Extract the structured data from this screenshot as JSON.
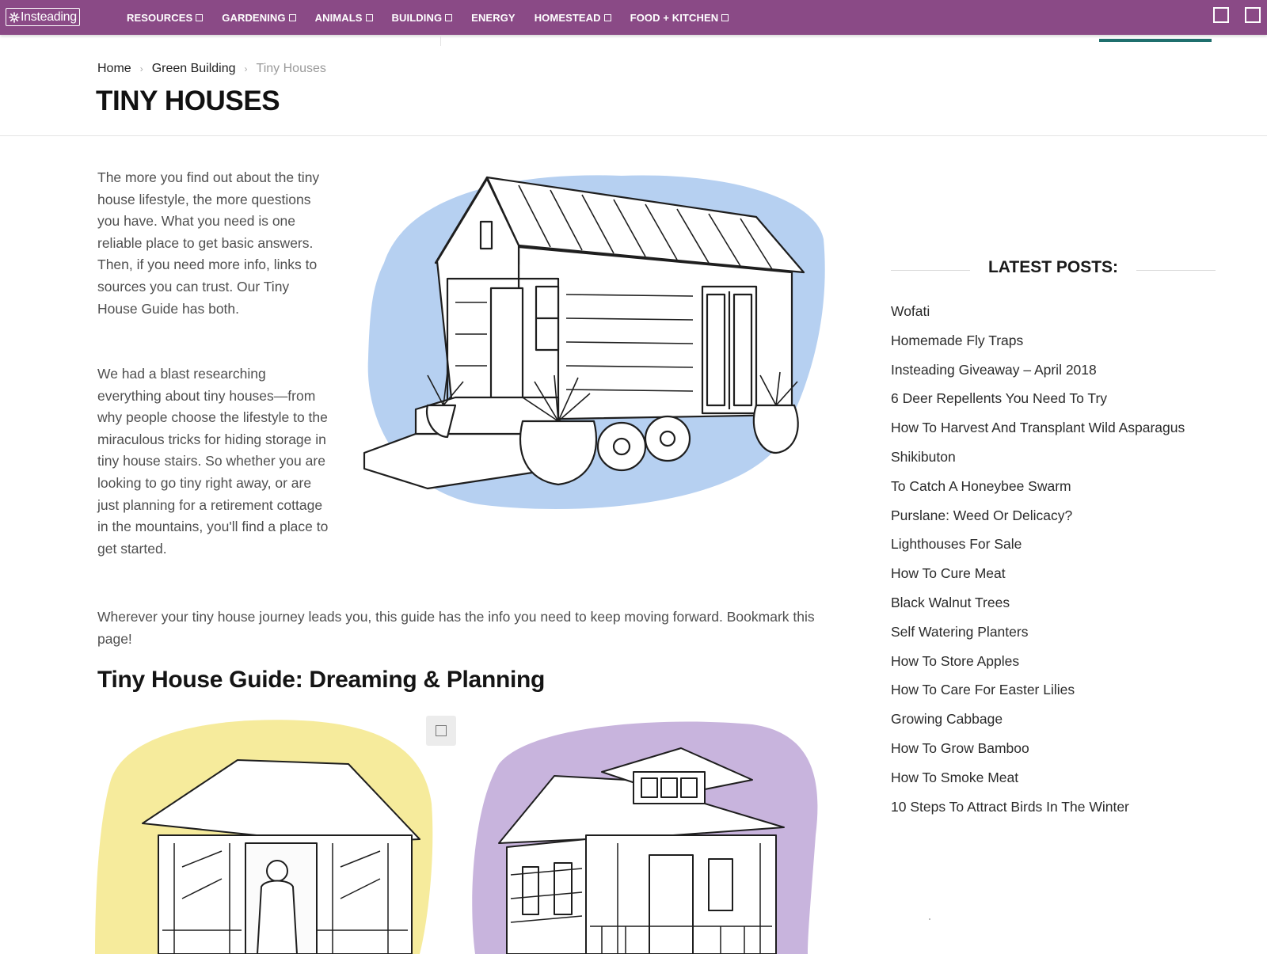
{
  "nav": {
    "logo_text": "Insteading",
    "items": [
      {
        "label": "RESOURCES",
        "has_dropdown": true
      },
      {
        "label": "GARDENING",
        "has_dropdown": true
      },
      {
        "label": "ANIMALS",
        "has_dropdown": true
      },
      {
        "label": "BUILDING",
        "has_dropdown": true
      },
      {
        "label": "ENERGY",
        "has_dropdown": false
      },
      {
        "label": "HOMESTEAD",
        "has_dropdown": true
      },
      {
        "label": "FOOD + KITCHEN",
        "has_dropdown": true
      }
    ],
    "right_icons": [
      "search-icon",
      "menu-icon"
    ],
    "colors": {
      "nav_bg": "#8a4a86",
      "accent": "#1f6f6d"
    }
  },
  "breadcrumb": [
    "Home",
    "Green Building",
    "Tiny Houses"
  ],
  "page_title": "TINY HOUSES",
  "intro": {
    "p1": "The more you find out about the tiny house lifestyle, the more questions you have. What you need is one reliable place to get basic answers. Then, if you need more info, links to sources you can trust. Our Tiny House Guide has both.",
    "p2": "We had a blast researching everything about tiny houses—from why people choose the lifestyle to the miraculous tricks for hiding storage in tiny house stairs. So whether you are looking to go tiny right away, or are just planning for a retirement cottage in the mountains, you'll find a place to get started.",
    "p3": "Wherever your tiny house journey leads you, this guide has the info you need to keep moving forward. Bookmark this page!"
  },
  "guide_heading": "Tiny House Guide: Dreaming & Planning",
  "sidebar": {
    "title": "LATEST POSTS:",
    "posts": [
      "Wofati",
      "Homemade Fly Traps",
      "Insteading Giveaway – April 2018",
      "6 Deer Repellents You Need To Try",
      "How To Harvest And Transplant Wild Asparagus",
      "Shikibuton",
      "To Catch A Honeybee Swarm",
      "Purslane: Weed Or Delicacy?",
      "Lighthouses For Sale",
      "How To Cure Meat",
      "Black Walnut Trees",
      "Self Watering Planters",
      "How To Store Apples",
      "How To Care For Easter Lilies",
      "Growing Cabbage",
      "How To Grow Bamboo",
      "How To Smoke Meat",
      "10 Steps To Attract Birds In The Winter"
    ]
  },
  "illustrations": {
    "hero_wash_color": "#a9c8ee",
    "left_wash_color": "#f5ea9a",
    "right_wash_color": "#c7b3dc"
  }
}
